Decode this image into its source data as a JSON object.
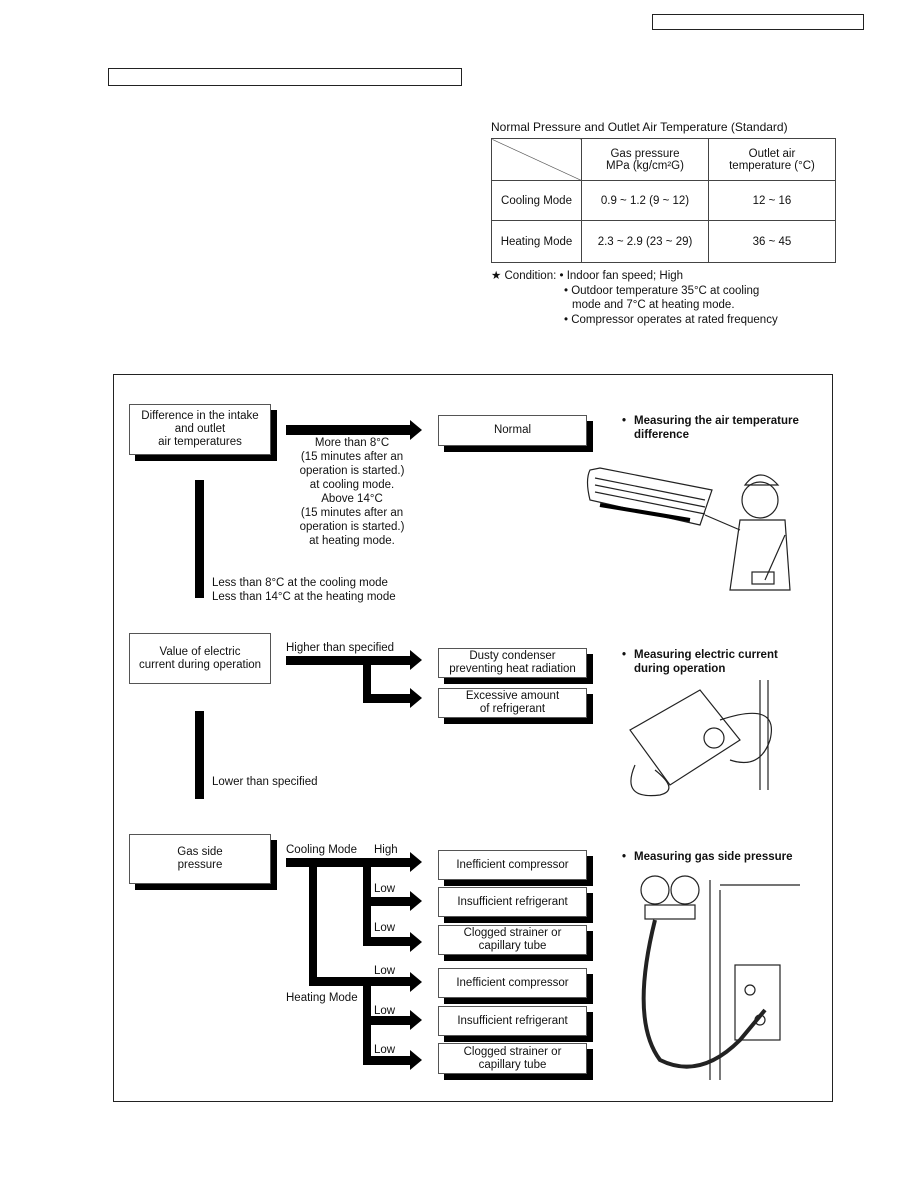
{
  "table": {
    "caption": "Normal Pressure and Outlet Air Temperature (Standard)",
    "headers": [
      "",
      "Gas pressure MPa (kg/cm²G)",
      "Outlet air temperature (°C)"
    ],
    "header_lines": {
      "gas": [
        "Gas pressure",
        "MPa (kg/cm²G)"
      ],
      "outlet": [
        "Outlet air",
        "temperature (°C)"
      ]
    },
    "rows": [
      {
        "mode": "Cooling Mode",
        "gas_pressure": "0.9 ~ 1.2 (9 ~ 12)",
        "outlet_temp": "12 ~ 16"
      },
      {
        "mode": "Heating Mode",
        "gas_pressure": "2.3 ~ 2.9 (23 ~ 29)",
        "outlet_temp": "36 ~ 45"
      }
    ]
  },
  "condition": {
    "label": "★ Condition:",
    "items": [
      "• Indoor fan speed; High",
      "• Outdoor temperature 35°C at cooling",
      "mode and 7°C at heating mode.",
      "• Compressor operates at rated frequency"
    ]
  },
  "flow": {
    "temp": {
      "box": [
        "Difference in the intake",
        "and outlet",
        "air temperatures"
      ],
      "yes_text": [
        "More than 8°C",
        "(15 minutes after an",
        "operation is started.)",
        "at cooling mode.",
        "Above 14°C",
        "(15 minutes after an",
        "operation is started.)",
        "at heating mode."
      ],
      "result": "Normal",
      "no_text": [
        "Less than 8°C at the cooling mode",
        "Less than 14°C at the heating mode"
      ],
      "note": [
        "Measuring the air temperature",
        "difference"
      ]
    },
    "current": {
      "box": [
        "Value of electric",
        "current during operation"
      ],
      "higher": "Higher than specified",
      "results": [
        [
          "Dusty condenser",
          "preventing heat radiation"
        ],
        [
          "Excessive amount",
          "of refrigerant"
        ]
      ],
      "lower": "Lower than specified",
      "note": [
        "Measuring electric current",
        "during operation"
      ]
    },
    "gas": {
      "box": [
        "Gas side",
        "pressure"
      ],
      "cooling": "Cooling Mode",
      "heating": "Heating Mode",
      "high": "High",
      "low": "Low",
      "results": [
        [
          "Inefficient compressor"
        ],
        [
          "Insufficient refrigerant"
        ],
        [
          "Clogged strainer or",
          "capillary tube"
        ],
        [
          "Inefficient compressor"
        ],
        [
          "Insufficient refrigerant"
        ],
        [
          "Clogged strainer or",
          "capillary tube"
        ]
      ],
      "note": [
        "Measuring gas side pressure"
      ]
    }
  }
}
